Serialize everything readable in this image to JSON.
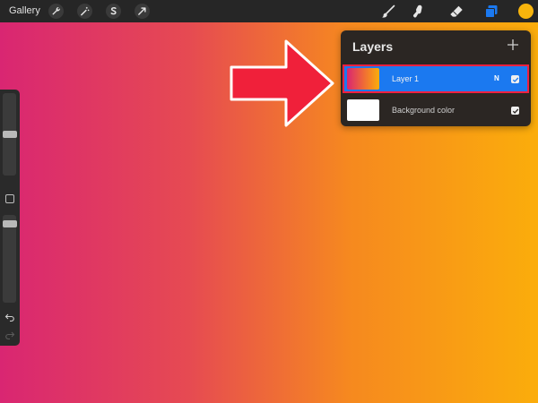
{
  "topbar": {
    "gallery_label": "Gallery",
    "left_tools": [
      {
        "icon": "wrench-icon"
      },
      {
        "icon": "magic-wand-icon"
      },
      {
        "icon": "selection-s-icon"
      },
      {
        "icon": "transform-arrow-icon"
      }
    ],
    "right_tools": [
      {
        "icon": "brush-icon"
      },
      {
        "icon": "smudge-icon"
      },
      {
        "icon": "eraser-icon"
      },
      {
        "icon": "layers-icon"
      }
    ],
    "current_color": "#f7b40c"
  },
  "layers_panel": {
    "title": "Layers",
    "add_icon": "plus-icon",
    "layers": [
      {
        "name": "Layer 1",
        "blend_mode": "N",
        "visible": true,
        "selected": true
      },
      {
        "name": "Background color",
        "visible": true,
        "selected": false
      }
    ]
  },
  "colors": {
    "selection_blue": "#1b79f0",
    "highlight_red": "#f02040",
    "arrow_red": "#f0203a"
  }
}
